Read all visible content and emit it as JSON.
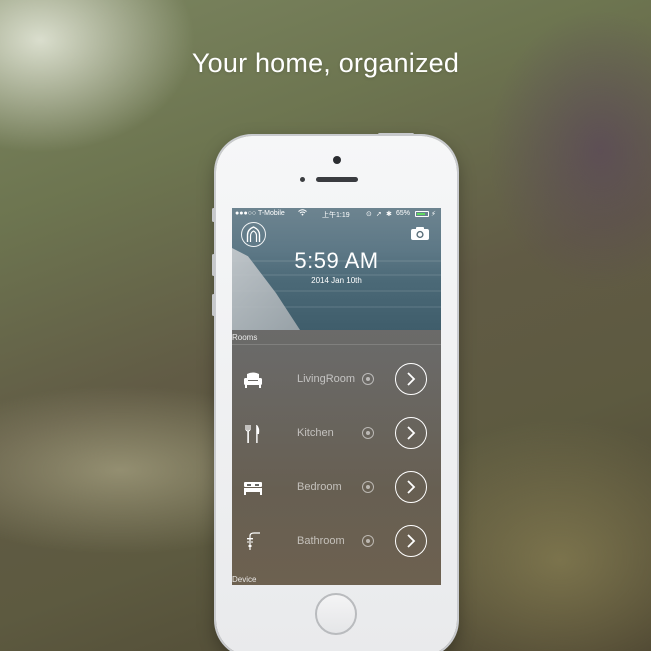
{
  "headline": "Your home, organized",
  "status_bar": {
    "carrier": "●●●○○ T-Mobile",
    "clock": "上午1:19",
    "battery": "65%"
  },
  "header": {
    "logo_icon": "home-arch-icon",
    "camera_icon": "camera-icon",
    "time": "5:59 AM",
    "date": "2014 Jan 10th"
  },
  "sections": {
    "rooms": "Rooms",
    "device": "Device"
  },
  "rooms": [
    {
      "label": "LivingRoom",
      "icon": "armchair-icon"
    },
    {
      "label": "Kitchen",
      "icon": "fork-knife-icon"
    },
    {
      "label": "Bedroom",
      "icon": "bed-icon"
    },
    {
      "label": "Bathroom",
      "icon": "shower-icon"
    }
  ],
  "colors": {
    "screen_text": "#ffffff",
    "battery_fill": "#5fd85f",
    "phone_body": "#f2f3f4"
  }
}
